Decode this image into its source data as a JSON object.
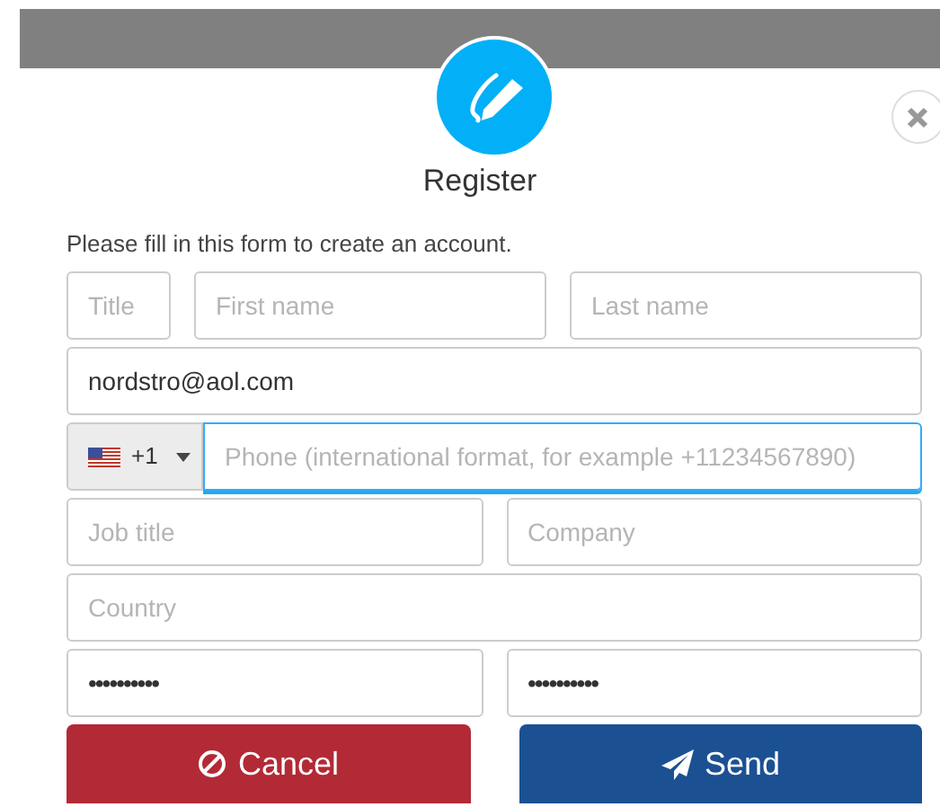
{
  "dialog": {
    "title": "Register",
    "intro": "Please fill in this form to create an account."
  },
  "rows": [
    [
      {
        "kind": "text",
        "placeholder": "Title"
      },
      {
        "kind": "text",
        "placeholder": "First name"
      },
      {
        "kind": "text",
        "placeholder": "Last name"
      }
    ],
    [
      {
        "kind": "text",
        "value": "nordstro@aol.com"
      }
    ],
    [
      {
        "kind": "phone",
        "country_code": "+1",
        "placeholder": "Phone (international format, for example +11234567890)",
        "focused": true
      }
    ],
    [
      {
        "kind": "text",
        "placeholder": "Job title"
      },
      {
        "kind": "text",
        "placeholder": "Company"
      }
    ],
    [
      {
        "kind": "text",
        "placeholder": "Country"
      }
    ],
    [
      {
        "kind": "password",
        "value": "••••••••••"
      },
      {
        "kind": "password",
        "value": "••••••••••"
      }
    ]
  ],
  "buttons": [
    {
      "kind": "cancel",
      "label": "Cancel"
    },
    {
      "kind": "send",
      "label": "Send"
    }
  ]
}
